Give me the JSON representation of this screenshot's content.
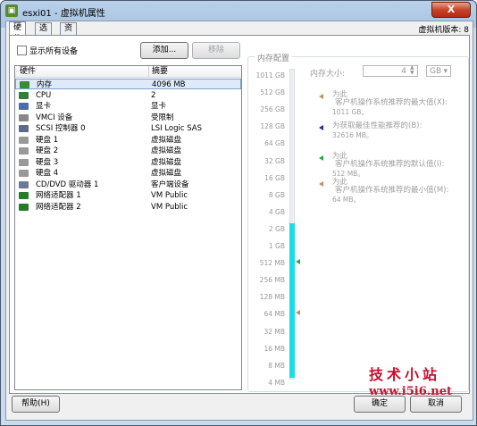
{
  "window": {
    "title": "esxi01 - 虚拟机属性",
    "close_label": "X"
  },
  "tabs": [
    {
      "label": "硬件"
    },
    {
      "label": "选项"
    },
    {
      "label": "资源"
    }
  ],
  "version": "虚拟机版本: 8",
  "hardware": {
    "show_all_label": "显示所有设备",
    "add_label": "添加...",
    "remove_label": "移除",
    "col_hardware": "硬件",
    "col_summary": "摘要",
    "rows": [
      {
        "name": "内存",
        "summary": "4096 MB",
        "icon": "memory-icon",
        "color": "#3a8a3a"
      },
      {
        "name": "CPU",
        "summary": "2",
        "icon": "cpu-icon",
        "color": "#3a7a3a"
      },
      {
        "name": "显卡",
        "summary": "显卡",
        "icon": "monitor-icon",
        "color": "#4a6fa8"
      },
      {
        "name": "VMCI 设备",
        "summary": "受限制",
        "icon": "vmci-icon",
        "color": "#888888"
      },
      {
        "name": "SCSI 控制器 0",
        "summary": "LSI Logic SAS",
        "icon": "scsi-icon",
        "color": "#5a6a8a"
      },
      {
        "name": "硬盘 1",
        "summary": "虚拟磁盘",
        "icon": "disk-icon",
        "color": "#999999"
      },
      {
        "name": "硬盘 2",
        "summary": "虚拟磁盘",
        "icon": "disk-icon",
        "color": "#999999"
      },
      {
        "name": "硬盘 3",
        "summary": "虚拟磁盘",
        "icon": "disk-icon",
        "color": "#999999"
      },
      {
        "name": "硬盘 4",
        "summary": "虚拟磁盘",
        "icon": "disk-icon",
        "color": "#999999"
      },
      {
        "name": "CD/DVD 驱动器 1",
        "summary": "客户端设备",
        "icon": "cdrom-icon",
        "color": "#6a7a9a"
      },
      {
        "name": "网络适配器 1",
        "summary": "VM Public",
        "icon": "network-icon",
        "color": "#2a7a2a"
      },
      {
        "name": "网络适配器 2",
        "summary": "VM Public",
        "icon": "network-icon",
        "color": "#2a7a2a"
      }
    ]
  },
  "memory": {
    "group_label": "内存配置",
    "size_label": "内存大小:",
    "size_value": "4",
    "unit": "GB",
    "scale": [
      "1011 GB",
      "512 GB",
      "256 GB",
      "128 GB",
      "64 GB",
      "32 GB",
      "16 GB",
      "8 GB",
      "4 GB",
      "2 GB",
      "1 GB",
      "512 MB",
      "256 MB",
      "128 MB",
      "64 MB",
      "32 MB",
      "16 MB",
      "8 MB",
      "4 MB"
    ],
    "fill_fraction": 0.5,
    "recommendations": [
      {
        "prefix": "为此",
        "label": "客户机操作系统推荐的最大值(X):",
        "value": "1011 GB。",
        "color": "#c0905a"
      },
      {
        "prefix": "",
        "label": "为获取最佳性能推荐的(B):",
        "value": "32616 MB。",
        "color": "#1a2aa8"
      },
      {
        "prefix": "为此",
        "label": "客户机操作系统推荐的默认值(I):",
        "value": "512 MB。",
        "color": "#2aa83a"
      },
      {
        "prefix": "为此",
        "label": "客户机操作系统推荐的最小值(M):",
        "value": "64 MB。",
        "color": "#c0905a"
      }
    ]
  },
  "footer": {
    "help_label": "帮助(H)",
    "ok_label": "确定",
    "cancel_label": "取消"
  },
  "watermark": {
    "line1": "技术小站",
    "line2": "www.i5i6.net"
  }
}
